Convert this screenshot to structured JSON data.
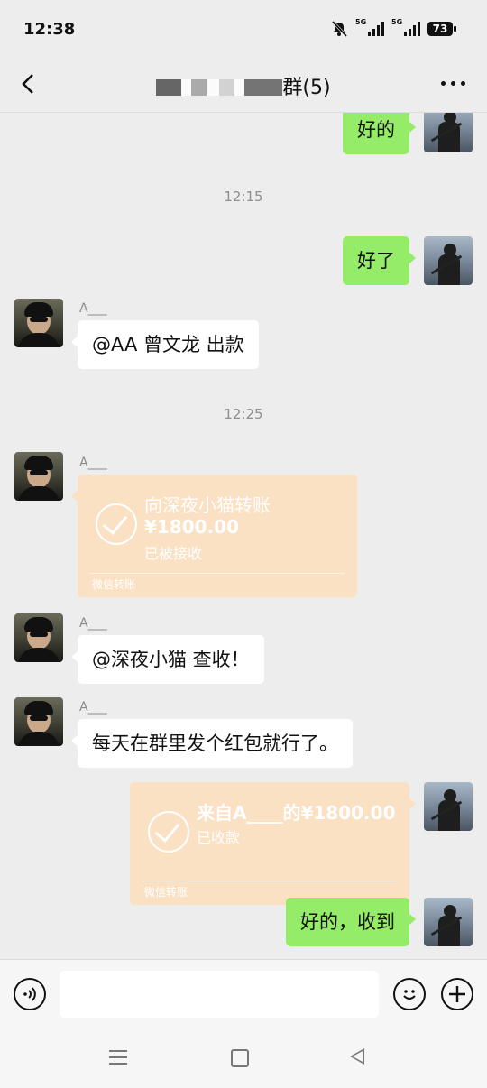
{
  "status": {
    "time": "12:38",
    "battery": "73",
    "network": "5G"
  },
  "header": {
    "title_suffix": "群(5)"
  },
  "messages": {
    "m1": "好的",
    "t1": "12:15",
    "m2": "好了",
    "m3_nick": "A___",
    "m3": "@AA 曾文龙  出款",
    "t2": "12:25",
    "m4_nick": "A___",
    "transfer1": {
      "title": "向深夜小猫转账",
      "amount": "¥1800.00",
      "status": "已被接收",
      "footer": "微信转账"
    },
    "m5_nick": "A___",
    "m5": "@深夜小猫  查收！",
    "m6_nick": "A___",
    "m6": "每天在群里发个红包就行了。",
    "transfer2": {
      "title": "来自A____的¥1800.00",
      "status": "已收款",
      "footer": "微信转账"
    },
    "m7": "好的，收到"
  }
}
